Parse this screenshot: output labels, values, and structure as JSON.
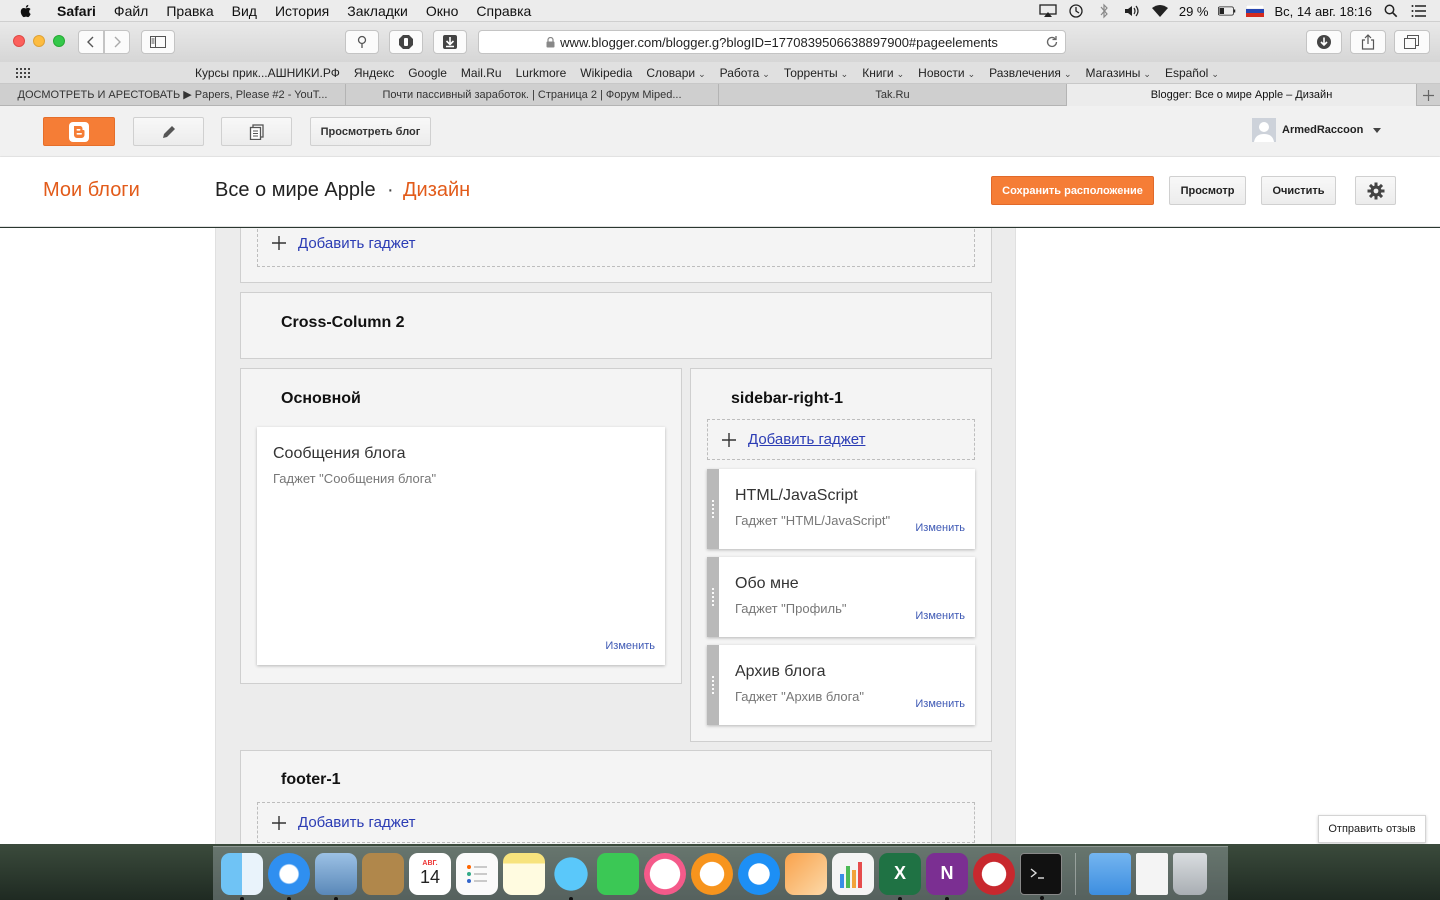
{
  "menubar": {
    "app": "Safari",
    "items": [
      "Файл",
      "Правка",
      "Вид",
      "История",
      "Закладки",
      "Окно",
      "Справка"
    ],
    "battery": "29 %",
    "datetime": "Вс, 14 авг.  18:16"
  },
  "browser": {
    "url": "www.blogger.com/blogger.g?blogID=1770839506638897900#pageelements",
    "favorites": [
      {
        "label": "Курсы прик...АШНИКИ.РФ",
        "menu": false
      },
      {
        "label": "Яндекс",
        "menu": false
      },
      {
        "label": "Google",
        "menu": false
      },
      {
        "label": "Mail.Ru",
        "menu": false
      },
      {
        "label": "Lurkmore",
        "menu": false
      },
      {
        "label": "Wikipedia",
        "menu": false
      },
      {
        "label": "Словари",
        "menu": true
      },
      {
        "label": "Работа",
        "menu": true
      },
      {
        "label": "Торренты",
        "menu": true
      },
      {
        "label": "Книги",
        "menu": true
      },
      {
        "label": "Новости",
        "menu": true
      },
      {
        "label": "Развлечения",
        "menu": true
      },
      {
        "label": "Магазины",
        "menu": true
      },
      {
        "label": "Español",
        "menu": true
      }
    ],
    "tabs": [
      {
        "label": "ДОСМОТРЕТЬ И АРЕСТОВАТЬ ▶ Papers, Please #2 - YouT...",
        "active": false
      },
      {
        "label": "Почти пассивный заработок. | Страница 2 | Форум Miped...",
        "active": false
      },
      {
        "label": "Tak.Ru",
        "active": false
      },
      {
        "label": "Blogger: Все о мире Apple – Дизайн",
        "active": true
      }
    ]
  },
  "blogger": {
    "view_blog": "Просмотреть блог",
    "user": "ArmedRaccoon",
    "my_blogs": "Мои блоги",
    "blog_name": "Все о мире Apple",
    "separator": "·",
    "section": "Дизайн",
    "save_layout": "Сохранить расположение",
    "preview": "Просмотр",
    "clear": "Очистить",
    "feedback": "Отправить отзыв",
    "brand_color": "#f57d36"
  },
  "layout": {
    "add_gadget": "Добавить гаджет",
    "edit": "Изменить",
    "cross_column_2": "Cross-Column 2",
    "main": {
      "title": "Основной",
      "widget": {
        "title": "Сообщения блога",
        "subtitle": "Гаджет \"Сообщения блога\""
      }
    },
    "sidebar": {
      "title": "sidebar-right-1",
      "widgets": [
        {
          "title": "HTML/JavaScript",
          "subtitle": "Гаджет \"HTML/JavaScript\""
        },
        {
          "title": "Обо мне",
          "subtitle": "Гаджет \"Профиль\""
        },
        {
          "title": "Архив блога",
          "subtitle": "Гаджет \"Архив блога\""
        }
      ]
    },
    "footer": {
      "title": "footer-1"
    }
  },
  "dock": {
    "apps": [
      "finder",
      "safari",
      "mail",
      "contacts",
      "calendar",
      "reminders",
      "notes",
      "messages",
      "facetime",
      "itunes",
      "ibooks",
      "app-store",
      "pages",
      "numbers",
      "excel",
      "onenote",
      "cleaner",
      "terminal"
    ],
    "calendar_month": "АВГ.",
    "calendar_day": "14"
  }
}
